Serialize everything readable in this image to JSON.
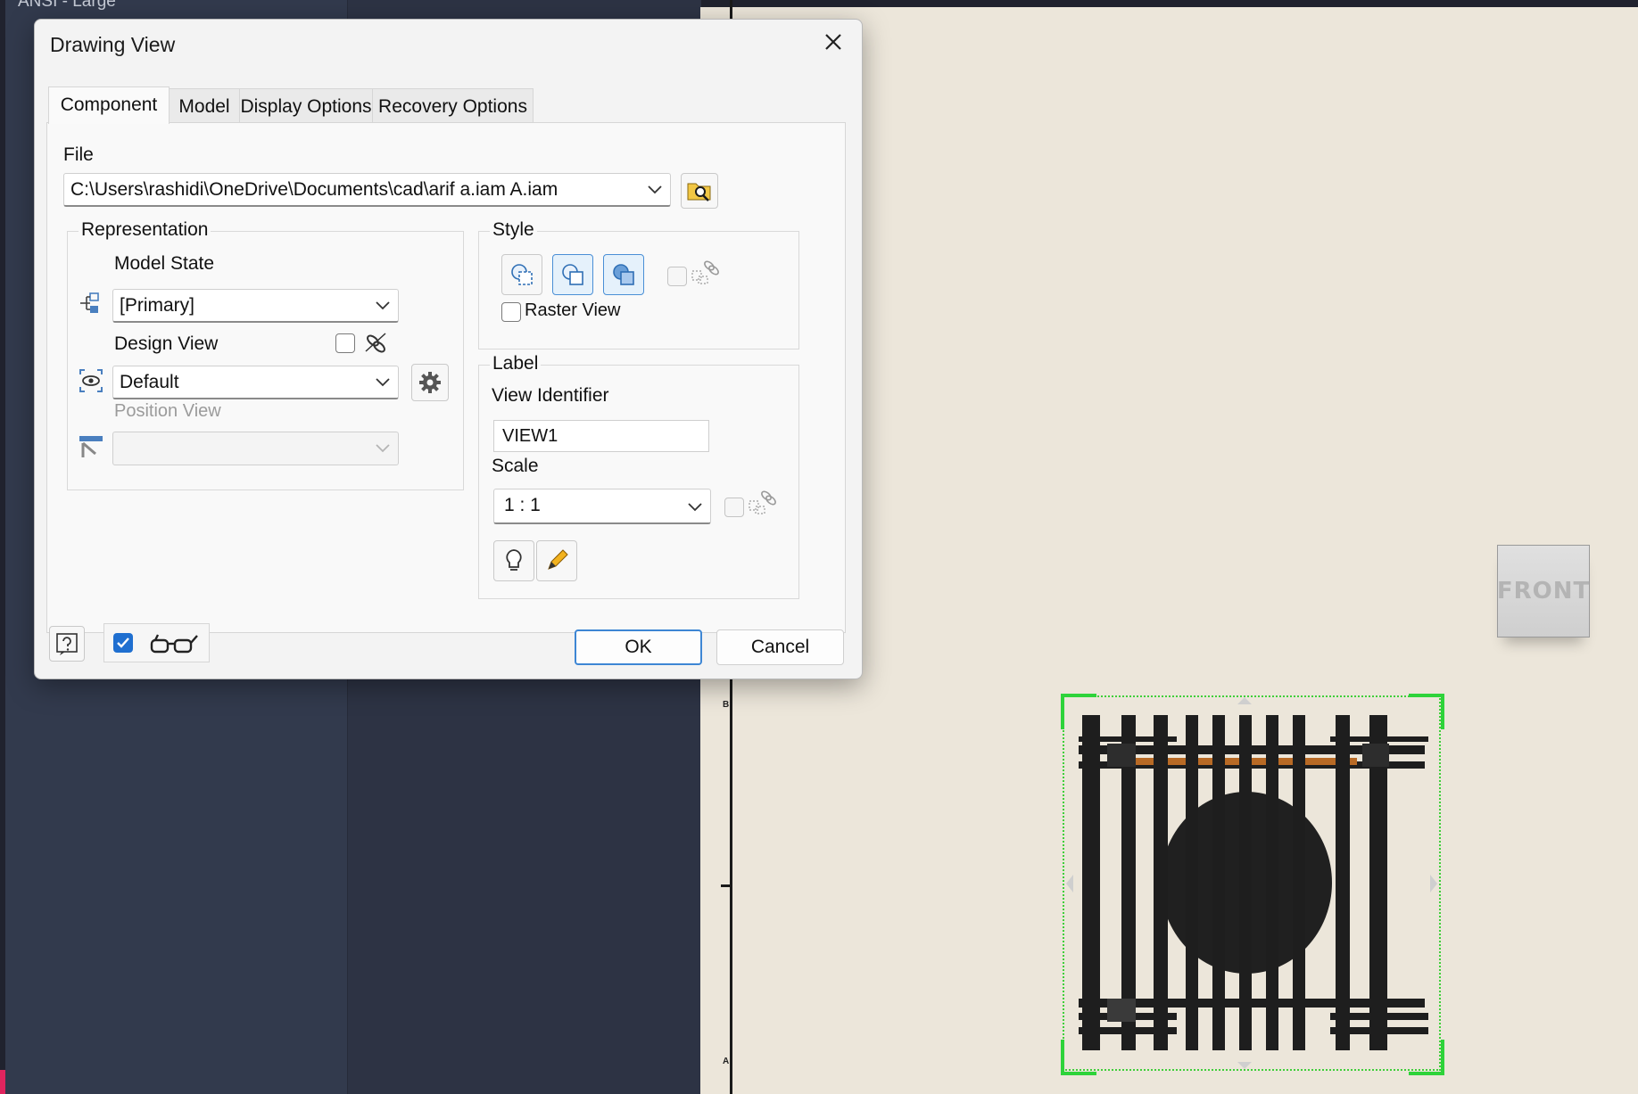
{
  "app": {
    "left_panel_title": "ANSI - Large",
    "zone_letters": [
      "B",
      "A"
    ],
    "viewcube_label": "FRONT",
    "accent_color": "#e0245e",
    "selection_color": "#2ed33a"
  },
  "dialog": {
    "title": "Drawing View",
    "tabs": [
      {
        "label": "Component",
        "active": true
      },
      {
        "label": "Model",
        "active": false
      },
      {
        "label": "Display Options",
        "active": false
      },
      {
        "label": "Recovery Options",
        "active": false
      }
    ],
    "file": {
      "label": "File",
      "value": "C:\\Users\\rashidi\\OneDrive\\Documents\\cad\\arif a.iam A.iam",
      "browse_icon": "folder-search-icon"
    },
    "representation": {
      "title": "Representation",
      "model_state_label": "Model State",
      "model_state_value": "[Primary]",
      "design_view_label": "Design View",
      "design_view_value": "Default",
      "design_view_associative": false,
      "position_view_label": "Position View",
      "position_view_value": ""
    },
    "style": {
      "title": "Style",
      "buttons": [
        {
          "icon": "hidden-line-icon",
          "selected": false
        },
        {
          "icon": "hidden-line-removed-icon",
          "selected": true
        },
        {
          "icon": "shaded-icon",
          "selected": true
        }
      ],
      "style_from_base": false,
      "raster_view_label": "Raster View",
      "raster_view_checked": false
    },
    "label": {
      "title": "Label",
      "view_identifier_label": "View Identifier",
      "view_identifier_value": "VIEW1",
      "scale_label": "Scale",
      "scale_value": "1 : 1",
      "scale_from_base": false,
      "toggle_visibility_icon": "lightbulb-icon",
      "edit_label_icon": "pencil-icon"
    },
    "footer": {
      "help_icon": "help-icon",
      "preview_checked": true,
      "preview_icon": "glasses-icon",
      "ok_label": "OK",
      "cancel_label": "Cancel"
    }
  }
}
